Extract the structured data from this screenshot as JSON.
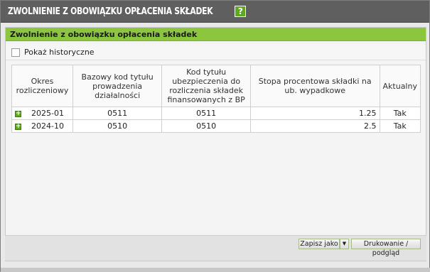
{
  "window": {
    "title": "ZWOLNIENIE Z OBOWIĄZKU OPŁACENIA SKŁADEK",
    "help_label": "?"
  },
  "panel": {
    "header": "Zwolnienie z obowiązku opłacenia składek",
    "show_history_label": "Pokaż historyczne",
    "show_history_checked": false
  },
  "table": {
    "columns": [
      "Okres rozliczeniowy",
      "Bazowy kod tytułu prowadzenia działalności",
      "Kod tytułu ubezpieczenia do rozliczenia składek finansowanych z BP",
      "Stopa procentowa składki na ub. wypadkowe",
      "Aktualny"
    ],
    "rows": [
      {
        "expand": "+",
        "period": "2025-01",
        "base_code": "0511",
        "insurance_code": "0511",
        "rate": "1.25",
        "current": "Tak"
      },
      {
        "expand": "+",
        "period": "2024-10",
        "base_code": "0510",
        "insurance_code": "0510",
        "rate": "2.5",
        "current": "Tak"
      }
    ]
  },
  "buttons": {
    "save_as": "Zapisz jako",
    "save_as_dropdown": "▼",
    "print": "Drukowanie / podgląd"
  },
  "colors": {
    "accent_green": "#8cc63f",
    "titlebar": "#5f5f5f"
  }
}
